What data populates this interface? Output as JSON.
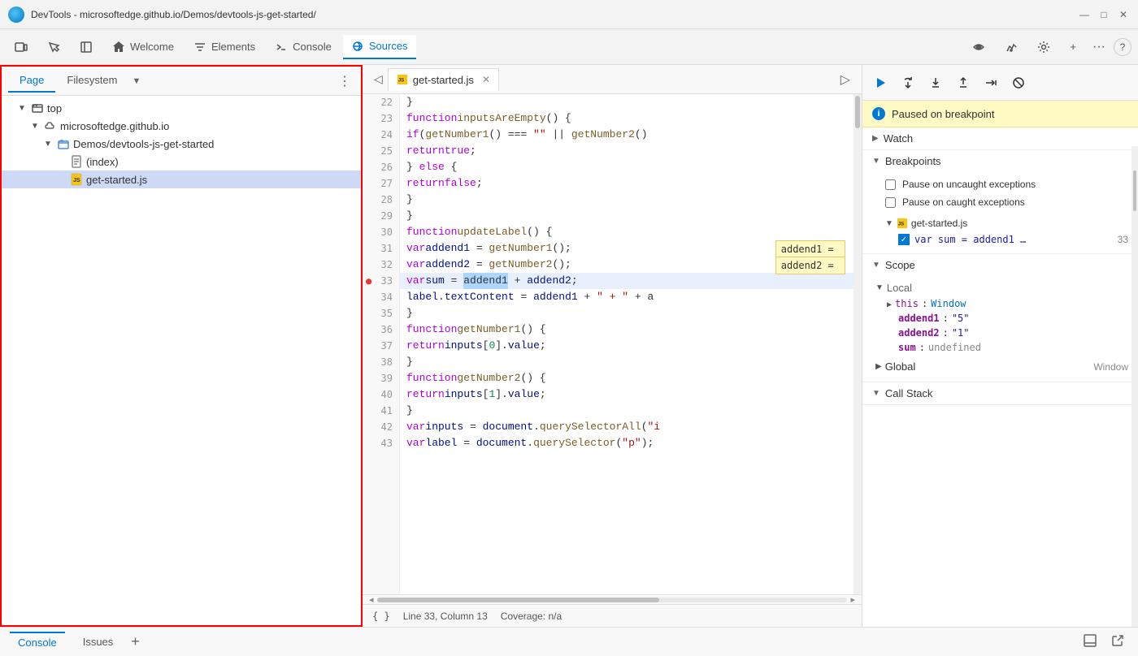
{
  "titlebar": {
    "title": "DevTools - microsoftedge.github.io/Demos/devtools-js-get-started/",
    "min_btn": "—",
    "max_btn": "□",
    "close_btn": "✕"
  },
  "tabbar": {
    "tabs": [
      {
        "id": "welcome",
        "label": "Welcome",
        "icon": "home"
      },
      {
        "id": "elements",
        "label": "Elements",
        "icon": "elements"
      },
      {
        "id": "console",
        "label": "Console",
        "icon": "console"
      },
      {
        "id": "sources",
        "label": "Sources",
        "icon": "sources",
        "active": true
      }
    ],
    "more_label": "···",
    "help_label": "?"
  },
  "left_panel": {
    "tabs": [
      {
        "id": "page",
        "label": "Page",
        "active": true
      },
      {
        "id": "filesystem",
        "label": "Filesystem"
      }
    ],
    "tree": [
      {
        "id": "top",
        "label": "top",
        "indent": 1,
        "type": "arrow-folder",
        "expanded": true,
        "arrow": "▼"
      },
      {
        "id": "microsoftedge",
        "label": "microsoftedge.github.io",
        "indent": 2,
        "type": "cloud-folder",
        "expanded": true,
        "arrow": "▼"
      },
      {
        "id": "demos-folder",
        "label": "Demos/devtools-js-get-started",
        "indent": 3,
        "type": "folder",
        "expanded": true,
        "arrow": "▼"
      },
      {
        "id": "index",
        "label": "(index)",
        "indent": 4,
        "type": "file"
      },
      {
        "id": "get-started-js",
        "label": "get-started.js",
        "indent": 4,
        "type": "js-file",
        "selected": true
      }
    ]
  },
  "editor": {
    "tab_label": "get-started.js",
    "lines": [
      {
        "num": 22,
        "content": "  }"
      },
      {
        "num": 23,
        "content": "  function inputsAreEmpty() {",
        "kw": "function",
        "fn": "inputsAreEmpty"
      },
      {
        "num": 24,
        "content": "    if (getNumber1() === \"\" || getNumber2()"
      },
      {
        "num": 25,
        "content": "      return true;"
      },
      {
        "num": 26,
        "content": "    } else {"
      },
      {
        "num": 27,
        "content": "      return false;"
      },
      {
        "num": 28,
        "content": "    }"
      },
      {
        "num": 29,
        "content": "  }"
      },
      {
        "num": 30,
        "content": "  function updateLabel() {",
        "kw": "function",
        "fn": "updateLabel"
      },
      {
        "num": 31,
        "content": "    var addend1 = getNumber1();",
        "tooltip": "addend1 = "
      },
      {
        "num": 32,
        "content": "    var addend2 = getNumber2();",
        "tooltip": "addend2 = "
      },
      {
        "num": 33,
        "content": "    var sum = addend1 + addend2;",
        "highlighted": true,
        "breakpoint": true,
        "selected_word": "addend1"
      },
      {
        "num": 34,
        "content": "    label.textContent = addend1 + \" + \" + a"
      },
      {
        "num": 35,
        "content": "  }"
      },
      {
        "num": 36,
        "content": "  function getNumber1() {",
        "kw": "function",
        "fn": "getNumber1"
      },
      {
        "num": 37,
        "content": "    return inputs[0].value;"
      },
      {
        "num": 38,
        "content": "  }"
      },
      {
        "num": 39,
        "content": "  function getNumber2() {",
        "kw": "function",
        "fn": "getNumber2"
      },
      {
        "num": 40,
        "content": "    return inputs[1].value;"
      },
      {
        "num": 41,
        "content": "  }"
      },
      {
        "num": 42,
        "content": "  var inputs = document.querySelectorAll(\"i"
      },
      {
        "num": 43,
        "content": "  var label = document.querySelector(\"p\");"
      }
    ],
    "statusbar": {
      "format": "{ }",
      "position": "Line 33, Column 13",
      "coverage": "Coverage: n/a"
    }
  },
  "right_panel": {
    "debug_buttons": [
      "resume",
      "step-over",
      "step-into",
      "step-out",
      "step",
      "deactivate"
    ],
    "breakpoint_banner": "Paused on breakpoint",
    "sections": [
      {
        "id": "watch",
        "label": "Watch",
        "expanded": false,
        "arrow": "▶"
      },
      {
        "id": "breakpoints",
        "label": "Breakpoints",
        "expanded": true,
        "arrow": "▼",
        "checkboxes": [
          {
            "label": "Pause on uncaught exceptions",
            "checked": false
          },
          {
            "label": "Pause on caught exceptions",
            "checked": false
          }
        ],
        "items": [
          {
            "file": "get-started.js",
            "code": "var sum = addend1 …",
            "line": "33",
            "checked": true
          }
        ]
      },
      {
        "id": "scope",
        "label": "Scope",
        "expanded": true,
        "arrow": "▼",
        "subsections": [
          {
            "id": "local",
            "label": "Local",
            "expanded": true,
            "arrow": "▼",
            "vars": [
              {
                "name": "this",
                "value": "Window",
                "type": "link"
              },
              {
                "name": "addend1",
                "value": "\"5\""
              },
              {
                "name": "addend2",
                "value": "\"1\""
              },
              {
                "name": "sum",
                "value": "undefined"
              }
            ]
          },
          {
            "id": "global",
            "label": "Global",
            "value": "Window",
            "expanded": false,
            "arrow": "▶"
          }
        ]
      },
      {
        "id": "callstack",
        "label": "Call Stack",
        "expanded": true,
        "arrow": "▼"
      }
    ]
  },
  "bottombar": {
    "tabs": [
      {
        "id": "console",
        "label": "Console",
        "active": true
      },
      {
        "id": "issues",
        "label": "Issues"
      }
    ],
    "add_label": "+",
    "right_icons": [
      "dock-bottom",
      "open-new"
    ]
  },
  "icons": {
    "home": "⌂",
    "elements": "</>",
    "console": ">_",
    "sources": "☰",
    "folder": "📁",
    "file": "📄",
    "js_file": "📜",
    "resume": "▶",
    "step_over": "↷",
    "step_into": "↓",
    "step_out": "↑",
    "step": "→",
    "deactivate": "⊘"
  }
}
